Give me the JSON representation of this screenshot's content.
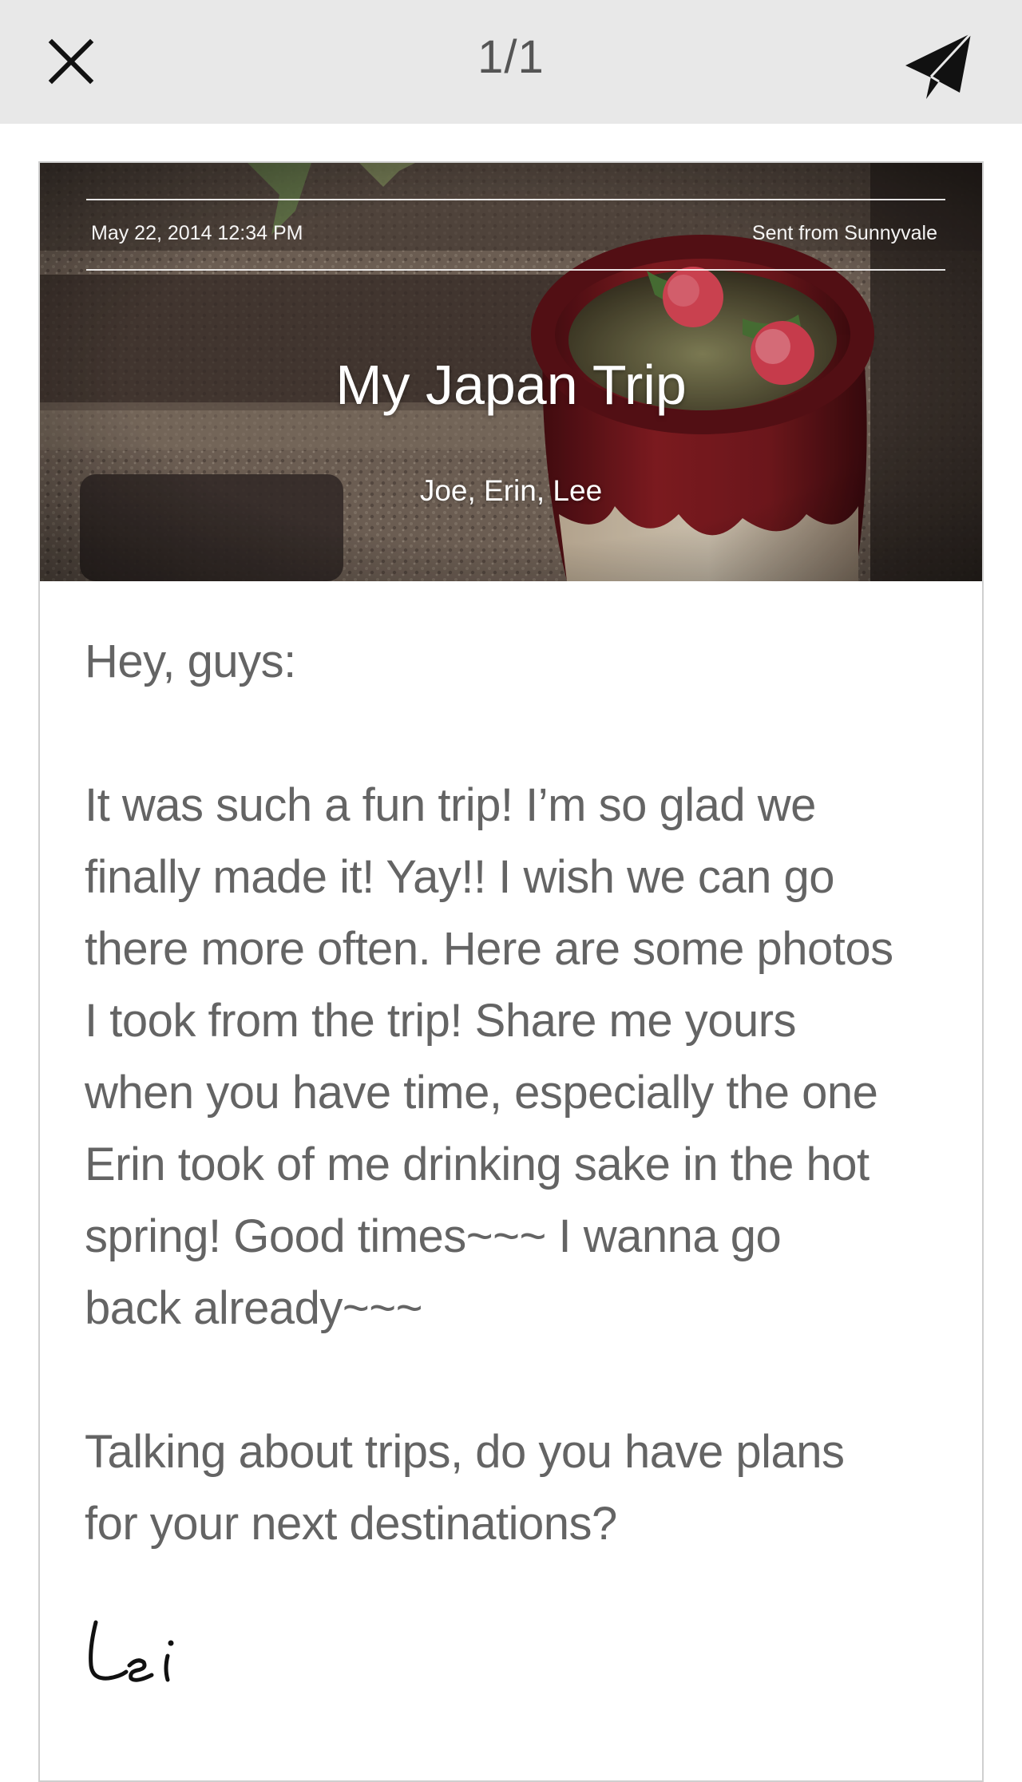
{
  "topbar": {
    "close_icon": "close-icon",
    "page_counter": "1/1",
    "send_icon": "paper-plane-icon"
  },
  "letter": {
    "header": {
      "date": "May 22, 2014 12:34 PM",
      "location": "Sent from Sunnyvale",
      "title": "My Japan Trip",
      "recipients": "Joe, Erin, Lee",
      "photo": "photo of a red ceramic pot with pink flowers on stone steps"
    },
    "body": {
      "greeting": "Hey, guys:",
      "lines_1": [
        "It was such a fun trip! I’m so glad we",
        "finally made it! Yay!! I wish we can go",
        "there more often. Here are some photos",
        "I took from the trip! Share me yours",
        "when you have time, especially the one",
        "Erin took of me drinking sake in the hot",
        "spring! Good times~~~ I wanna go",
        "back already~~~"
      ],
      "lines_2": [
        "Talking about trips, do you have plans",
        "for your next destinations?"
      ]
    },
    "signature": "Lei"
  },
  "colors": {
    "topbar_bg": "#e8e8e8",
    "text": "#646464",
    "card_border": "#cfcfcf"
  }
}
